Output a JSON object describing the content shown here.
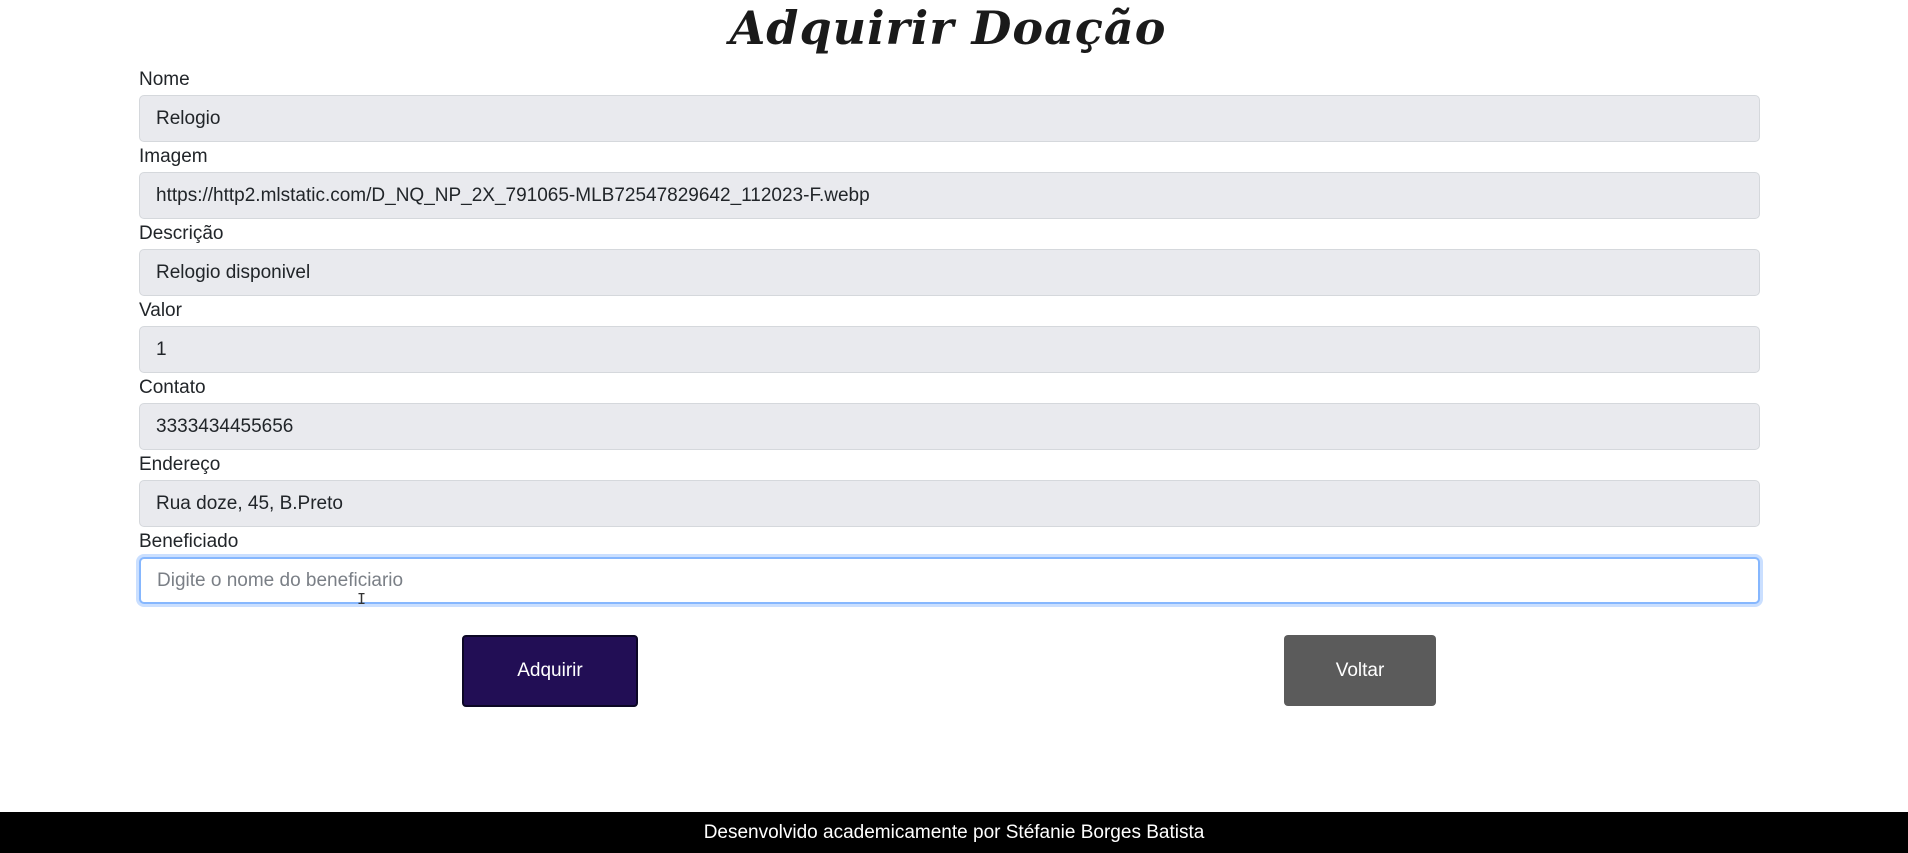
{
  "page": {
    "title": "Adquirir Doação"
  },
  "form": {
    "fields": [
      {
        "label": "Nome",
        "value": "Relogio"
      },
      {
        "label": "Imagem",
        "value": "https://http2.mlstatic.com/D_NQ_NP_2X_791065-MLB72547829642_112023-F.webp"
      },
      {
        "label": "Descrição",
        "value": "Relogio disponivel"
      },
      {
        "label": "Valor",
        "value": "1"
      },
      {
        "label": "Contato",
        "value": "3333434455656"
      },
      {
        "label": "Endereço",
        "value": "Rua doze, 45, B.Preto"
      },
      {
        "label": "Beneficiado",
        "value": "",
        "placeholder": "Digite o nome do beneficiario"
      }
    ]
  },
  "actions": {
    "acquire_label": "Adquirir",
    "back_label": "Voltar",
    "acquire_color": "#220e55",
    "back_color": "#5b5b5b"
  },
  "footer": {
    "text": "Desenvolvido academicamente por Stéfanie Borges Batista"
  }
}
